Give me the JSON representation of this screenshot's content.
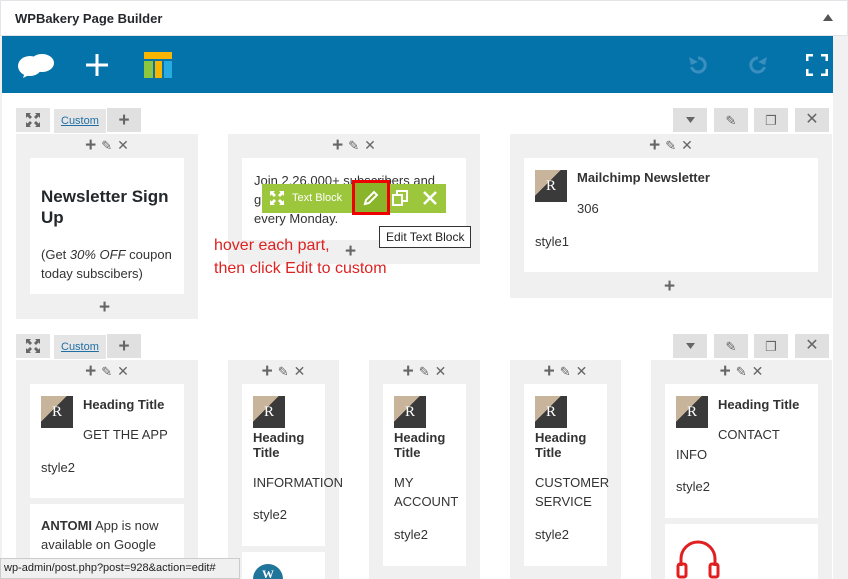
{
  "header": {
    "title": "WPBakery Page Builder"
  },
  "toolbar": {
    "icons": [
      "cloud-logo-icon",
      "add-element-icon",
      "templates-icon",
      "undo-icon",
      "redo-icon",
      "fullscreen-icon"
    ],
    "accent": "#0473aa"
  },
  "rows": [
    {
      "custom_label": "Custom"
    },
    {
      "custom_label": "Custom"
    }
  ],
  "row1": {
    "col1": {
      "heading": "Newsletter Sign Up",
      "text_pre": "(Get ",
      "text_em": "30% OFF",
      "text_post": " coupon today subscibers)"
    },
    "col2": {
      "line1": "Join 2.26.000+ subscribers and",
      "line2": "g",
      "line3": "every Monday."
    },
    "col3": {
      "title": "Mailchimp Newsletter",
      "value": "306",
      "style": "style1"
    }
  },
  "hover_toolbar": {
    "label": "Text Block",
    "tooltip": "Edit Text Block"
  },
  "annotation": {
    "line1": "hover each part,",
    "line2": "then click Edit to custom"
  },
  "row2": {
    "col1": {
      "title": "Heading Title",
      "sub": "GET THE APP",
      "style": "style2",
      "extra1": "ANTOMI",
      "extra2": " App is now available on Google"
    },
    "col2": {
      "title": "Heading Title",
      "sub": "INFORMATION",
      "style": "style2"
    },
    "col3": {
      "title": "Heading Title",
      "sub1": "MY",
      "sub2": "ACCOUNT",
      "style": "style2"
    },
    "col4": {
      "title": "Heading Title",
      "sub1": "CUSTOMER",
      "sub2": "SERVICE",
      "style": "style2"
    },
    "col5": {
      "title": "Heading Title",
      "sub1": "CONTACT",
      "sub2": "INFO",
      "style": "style2"
    }
  },
  "status": {
    "url": "wp-admin/post.php?post=928&action=edit#"
  }
}
